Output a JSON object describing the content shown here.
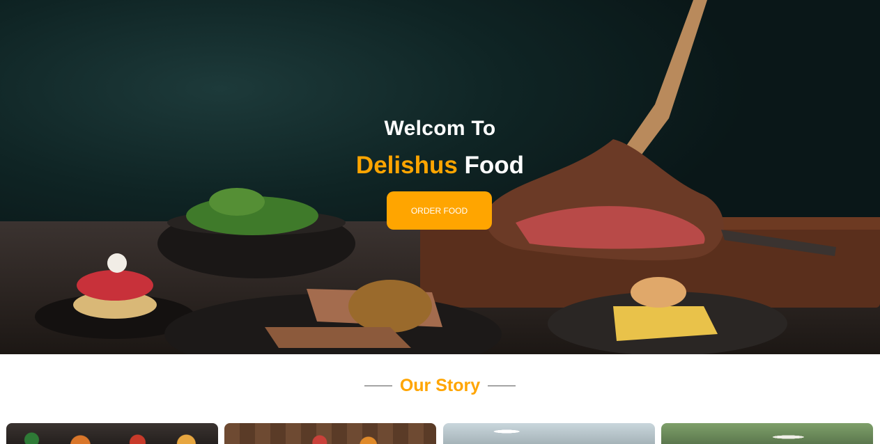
{
  "hero": {
    "welcome": "Welcom To",
    "brand_accent": "Delishus",
    "brand_rest": "Food",
    "order_button": "ORDER FOOD",
    "image": "food-table-spread"
  },
  "story": {
    "title": "Our Story",
    "cards": [
      {
        "image": "food-platter-photo"
      },
      {
        "image": "wooden-table-dishes-photo"
      },
      {
        "image": "restaurant-interior-photo"
      },
      {
        "image": "outdoor-patio-photo"
      }
    ]
  },
  "colors": {
    "accent": "#ffa500",
    "hero_text": "#ffffff",
    "hero_background": "#0f2424"
  }
}
